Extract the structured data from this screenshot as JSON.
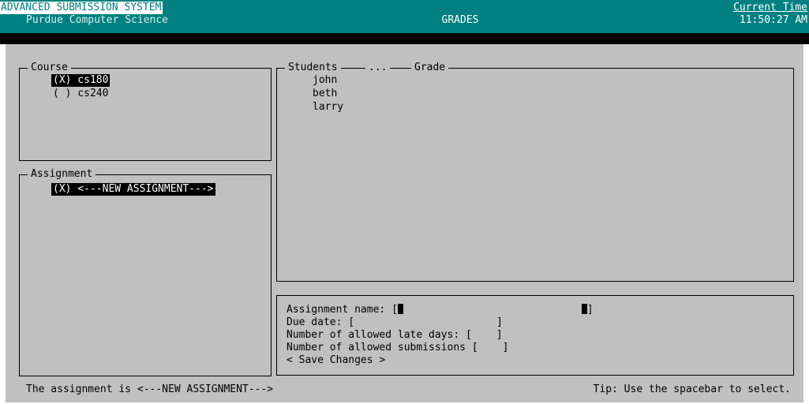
{
  "header": {
    "system_title": "ADVANCED SUBMISSION SYSTEM",
    "organization": "Purdue Computer Science",
    "page": "GRADES",
    "time_label": "Current Time",
    "time_value": "11:50:27 AM"
  },
  "course_panel": {
    "title": "Course",
    "options": [
      {
        "label": "(X) cs180",
        "selected": true
      },
      {
        "label": "( ) cs240",
        "selected": false
      }
    ]
  },
  "assignment_panel": {
    "title": "Assignment",
    "options": [
      {
        "label": "(X) <---NEW ASSIGNMENT--->",
        "selected": true
      }
    ]
  },
  "grades_panel": {
    "students_header": "Students",
    "ellipsis": "...",
    "grade_header": "Grade",
    "students": [
      "john",
      "beth",
      "larry"
    ]
  },
  "form": {
    "assignment_name_label": "Assignment name: ",
    "assignment_name_value": "",
    "due_date_label": "Due date: ",
    "due_date_value": "",
    "late_days_label": "Number of allowed late days: ",
    "late_days_value": "",
    "submissions_label": "Number of allowed submissions ",
    "submissions_value": "",
    "save_button": "< Save Changes >"
  },
  "status": {
    "left": "The assignment is <---NEW ASSIGNMENT--->",
    "right": "Tip: Use the spacebar to select."
  }
}
